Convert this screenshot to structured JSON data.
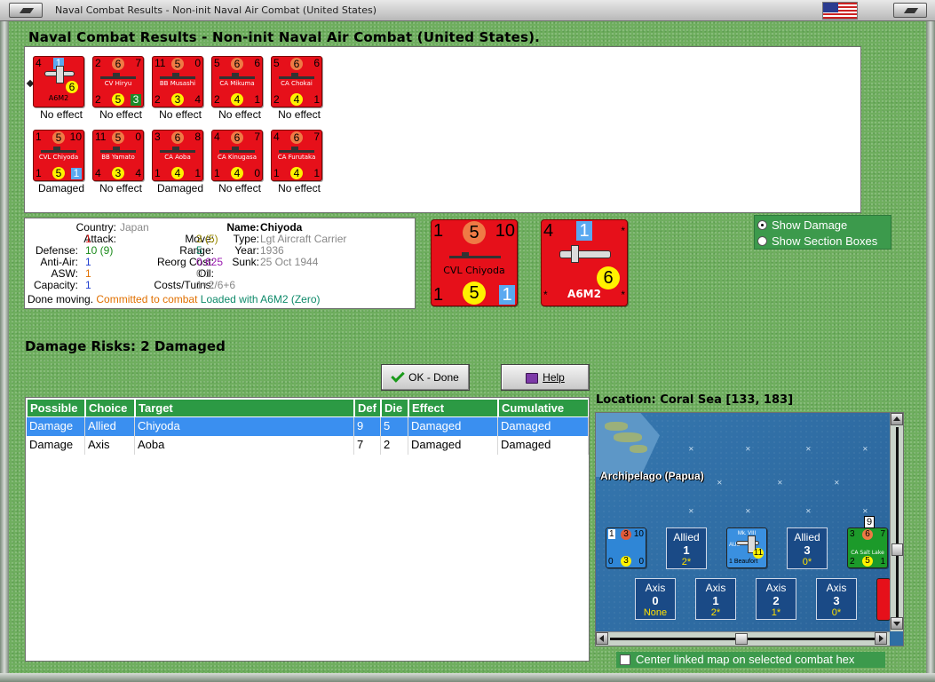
{
  "window": {
    "title": "Naval Combat Results - Non-init Naval Air Combat (United States)"
  },
  "heading": "Naval Combat Results - Non-init Naval Air Combat (United States).",
  "results": [
    {
      "tl": "4",
      "tm": "1",
      "tr": "",
      "bl": "",
      "bm": "6",
      "br": "",
      "name": "A6M2",
      "effect": "No effect"
    },
    {
      "tl": "2",
      "tm": "6",
      "tr": "7",
      "bl": "2",
      "bm": "5",
      "br": "3",
      "name": "CV Hiryu",
      "effect": "No effect"
    },
    {
      "tl": "11",
      "tm": "5",
      "tr": "0",
      "bl": "2",
      "bm": "3",
      "br": "4",
      "name": "BB Musashi",
      "effect": "No effect"
    },
    {
      "tl": "5",
      "tm": "6",
      "tr": "6",
      "bl": "2",
      "bm": "4",
      "br": "1",
      "name": "CA Mikuma",
      "effect": "No effect"
    },
    {
      "tl": "5",
      "tm": "6",
      "tr": "6",
      "bl": "2",
      "bm": "4",
      "br": "1",
      "name": "CA Chokai",
      "effect": "No effect"
    },
    {
      "tl": "1",
      "tm": "5",
      "tr": "10",
      "bl": "1",
      "bm": "5",
      "br": "1",
      "name": "CVL Chiyoda",
      "effect": "Damaged"
    },
    {
      "tl": "11",
      "tm": "5",
      "tr": "0",
      "bl": "4",
      "bm": "3",
      "br": "4",
      "name": "BB Yamato",
      "effect": "No effect"
    },
    {
      "tl": "3",
      "tm": "6",
      "tr": "8",
      "bl": "1",
      "bm": "4",
      "br": "1",
      "name": "CA Aoba",
      "effect": "Damaged"
    },
    {
      "tl": "4",
      "tm": "6",
      "tr": "7",
      "bl": "1",
      "bm": "4",
      "br": "0",
      "name": "CA Kinugasa",
      "effect": "No effect"
    },
    {
      "tl": "4",
      "tm": "6",
      "tr": "7",
      "bl": "1",
      "bm": "4",
      "br": "1",
      "name": "CA Furutaka",
      "effect": "No effect"
    }
  ],
  "info": {
    "country_label": "Country:",
    "country": "Japan",
    "attack_label": "Attack:",
    "attack": "1",
    "defense_label": "Defense:",
    "defense": "10 (9)",
    "antiair_label": "Anti-Air:",
    "antiair": "1",
    "asw_label": "ASW:",
    "asw": "1",
    "capacity_label": "Capacity:",
    "capacity": "1",
    "name_label": "Name:",
    "name": "Chiyoda",
    "move_label": "Move:",
    "move": "3 (5)",
    "range_label": "Range:",
    "range": "5",
    "reorg_label": "Reorg Cost:",
    "reorg": "0.625",
    "oil_label": "Oil:",
    "oil": "0.1",
    "costs_label": "Costs/Turns:",
    "costs": "1+2/6+6",
    "type_label": "Type:",
    "type": "Lgt Aircraft Carrier",
    "year_label": "Year:",
    "year": "1936",
    "sunk_label": "Sunk:",
    "sunk": "25 Oct 1944",
    "status_done": "Done moving.",
    "status_committed": "Committed to combat",
    "status_loaded": "Loaded with A6M2 (Zero)"
  },
  "big_ship": {
    "tl": "1",
    "tm": "5",
    "tr": "10",
    "name": "CVL Chiyoda",
    "bl": "1",
    "bm": "5",
    "br": "1"
  },
  "big_plane": {
    "tl": "4",
    "tm": "1",
    "tr": "*",
    "bm": "6",
    "bl": "*",
    "name": "A6M2",
    "br": "*"
  },
  "options": {
    "show_damage": "Show Damage",
    "show_section_boxes": "Show Section Boxes"
  },
  "damage_risks": "Damage Risks:  2 Damaged",
  "buttons": {
    "ok": "OK - Done",
    "help": "Help"
  },
  "table": {
    "headers": [
      "Possible",
      "Choice",
      "Target",
      "Def",
      "Die",
      "Effect",
      "Cumulative"
    ],
    "rows": [
      [
        "Damage",
        "Allied",
        "Chiyoda",
        "9",
        "5",
        "Damaged",
        "Damaged"
      ],
      [
        "Damage",
        "Axis",
        "Aoba",
        "7",
        "2",
        "Damaged",
        "Damaged"
      ]
    ]
  },
  "location": "Location:  Coral Sea [133, 183]",
  "map": {
    "area_label": "Archipelago (Papua)",
    "stack_counter_1": {
      "tl": "1",
      "tm": "3",
      "tr": "10",
      "bl": "0",
      "bm": "3",
      "br": "0"
    },
    "stack_counter_2": {
      "top": "Mk. VIII",
      "name": "1 Beaufort",
      "bm": "11",
      "side": "AUS"
    },
    "stack_counter_3": {
      "top": "9",
      "tl": "3",
      "tm": "6",
      "tr": "7",
      "name": "CA Salt Lake",
      "bl": "2",
      "bm": "5",
      "br": "1"
    },
    "allied_boxes": [
      {
        "side": "Allied",
        "num": "1",
        "val": "2*"
      },
      {
        "side": "Allied",
        "num": "3",
        "val": "0*"
      }
    ],
    "axis_boxes": [
      {
        "side": "Axis",
        "num": "0",
        "val": "None"
      },
      {
        "side": "Axis",
        "num": "1",
        "val": "2*"
      },
      {
        "side": "Axis",
        "num": "2",
        "val": "1*"
      },
      {
        "side": "Axis",
        "num": "3",
        "val": "0*"
      }
    ]
  },
  "center_map_option": "Center linked map on selected combat hex"
}
